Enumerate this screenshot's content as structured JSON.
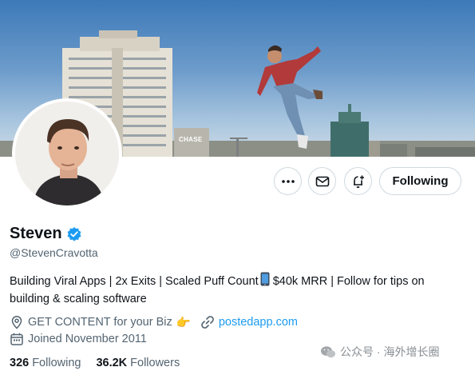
{
  "banner": {
    "sign_text": "CHASE"
  },
  "actions": {
    "more_icon": "more-dots-icon",
    "message_icon": "envelope-icon",
    "notify_icon": "bell-plus-icon",
    "follow_label": "Following"
  },
  "profile": {
    "name": "Steven",
    "verified": true,
    "handle": "@StevenCravotta",
    "bio_part1": "Building Viral Apps | 2x Exits | Scaled Puff Count",
    "bio_part2": "$40k MRR | Follow for tips on building & scaling software",
    "location": "GET CONTENT for your Biz",
    "location_emoji": "👉",
    "website": "postedapp.com",
    "joined": "Joined November 2011"
  },
  "stats": {
    "following_count": "326",
    "following_label": "Following",
    "followers_count": "36.2K",
    "followers_label": "Followers"
  },
  "watermark": {
    "text": "公众号 · 海外增长圈"
  },
  "colors": {
    "accent": "#1d9bf0",
    "text_primary": "#0f1419",
    "text_secondary": "#536471",
    "border": "#cfd9de"
  }
}
